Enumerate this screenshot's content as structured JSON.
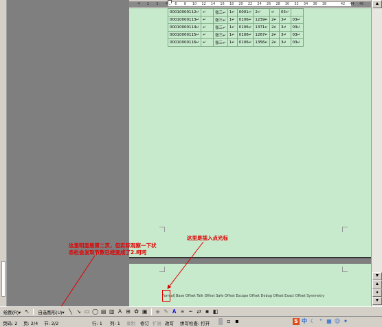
{
  "ruler": {
    "ticks": [
      "4",
      "2",
      "2",
      "4",
      "6",
      "8",
      "10",
      "12",
      "14",
      "16",
      "18",
      "20",
      "22",
      "24",
      "26",
      "28",
      "30",
      "32",
      "34",
      "36",
      "38",
      "",
      "42",
      "44",
      "46"
    ]
  },
  "table": {
    "rows": [
      [
        "00010000112↵",
        "↵",
        "张三↵",
        "1↵",
        "0001↵",
        "2↵",
        "↵",
        "03↵"
      ],
      [
        "00010000113↵",
        "↵",
        "张三↵",
        "1↵",
        "0106↵",
        "1239↵",
        "2↵",
        "3↵",
        "03↵"
      ],
      [
        "00010000114↵",
        "↵",
        "张三↵",
        "1↵",
        "0106↵",
        "1371↵",
        "2↵",
        "3↵",
        "03↵"
      ],
      [
        "00010000115↵",
        "↵",
        "张三↵",
        "1↵",
        "0106↵",
        "1267↵",
        "2↵",
        "3↵",
        "03↵"
      ],
      [
        "00010000116↵",
        "↵",
        "张三↵",
        "1↵",
        "0106↵",
        "1356↵",
        "2↵",
        "3↵",
        "03↵"
      ]
    ]
  },
  "page2": {
    "code_text": "Formal│Base Offset Talk Offset Safe Offset Escape Offset Debug Offset Exact Offset Symmetry"
  },
  "annotations": {
    "left_line1": "这里明显是第二页，但实际观察一下状",
    "left_line2": "态栏会发现节数已经变成了2.呵呵",
    "right": "这里是插入点光标"
  },
  "drawbar": {
    "draw_label": "绘图(R)▾",
    "autoshapes_label": "自选图形(U)▾"
  },
  "status": {
    "page": "页码: 2",
    "page_of": "页: 2/4",
    "section": "节: 2/2",
    "row": "行: 1",
    "col": "列: 1",
    "record": "录制",
    "revise": "修订",
    "extend": "扩展",
    "overwrite": "改写",
    "spellcheck": "拼写检查: 打开",
    "ime_label": "中"
  },
  "colors": {
    "page_bg": "#c7e9cc",
    "workspace_gray": "#7f7f7f",
    "annotation_red": "#e00000"
  }
}
